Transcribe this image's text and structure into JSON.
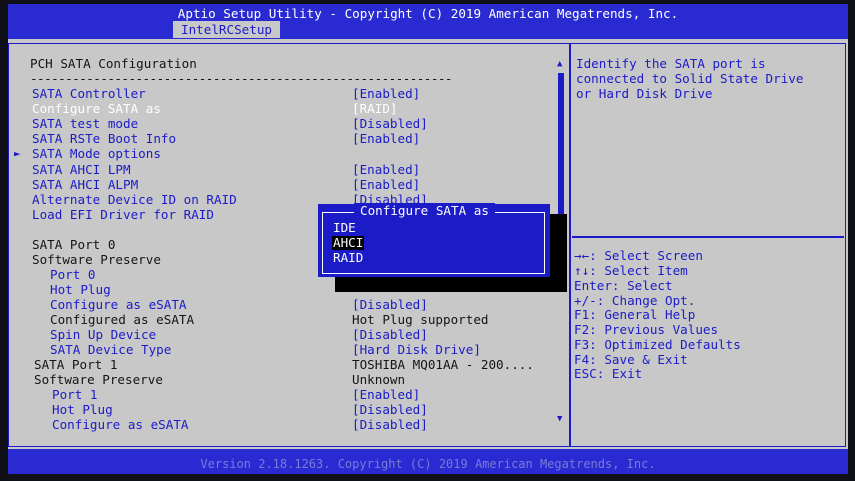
{
  "header": {
    "title": "Aptio Setup Utility - Copyright (C) 2019 American Megatrends, Inc.",
    "tab": "IntelRCSetup"
  },
  "section": {
    "title": "PCH SATA Configuration",
    "divider": "------------------------------------------------------------"
  },
  "pointer": "►",
  "settings": {
    "sata_controller": {
      "label": "SATA Controller",
      "value": "[Enabled]"
    },
    "configure_sata_as": {
      "label": "Configure SATA as",
      "value": "[RAID]"
    },
    "sata_test_mode": {
      "label": "SATA test mode",
      "value": "[Disabled]"
    },
    "sata_rste_boot_info": {
      "label": "SATA RSTe Boot Info",
      "value": "[Enabled]"
    },
    "sata_mode_options": {
      "label": "SATA Mode options"
    },
    "sata_ahci_lpm": {
      "label": "SATA AHCI LPM",
      "value": "[Enabled]"
    },
    "sata_ahci_alpm": {
      "label": "SATA AHCI ALPM",
      "value": "[Enabled]"
    },
    "alternate_device_id": {
      "label": "Alternate Device ID on RAID",
      "value": "[Disabled]"
    },
    "load_efi_driver": {
      "label": "Load EFI Driver for RAID"
    },
    "port0": {
      "header": "SATA Port 0",
      "software_preserve": "Software Preserve",
      "port_label": "Port 0",
      "hot_plug_label": "Hot Plug",
      "configure_esata": {
        "label": "Configure as eSATA",
        "value": "[Disabled]"
      },
      "configured_as_esata": {
        "label": "Configured as eSATA",
        "value": "Hot Plug supported"
      },
      "spin_up": {
        "label": "Spin Up Device",
        "value": "[Disabled]"
      },
      "device_type": {
        "label": "SATA Device Type",
        "value": "[Hard Disk Drive]"
      }
    },
    "port1": {
      "header": "SATA Port 1",
      "header_value": "TOSHIBA MQ01AA - 200....",
      "software_preserve": "Software Preserve",
      "software_preserve_value": "Unknown",
      "port": {
        "label": "Port 1",
        "value": "[Enabled]"
      },
      "hot_plug": {
        "label": "Hot Plug",
        "value": "[Disabled]"
      },
      "configure_esata": {
        "label": "Configure as eSATA",
        "value": "[Disabled]"
      }
    }
  },
  "popup": {
    "title": "Configure SATA as",
    "options": [
      "IDE",
      "AHCI",
      "RAID"
    ],
    "selected": "AHCI"
  },
  "help": {
    "lines": [
      "Identify the SATA port is",
      "connected to Solid State Drive",
      "or Hard Disk Drive"
    ]
  },
  "keys": [
    "→←: Select Screen",
    "↑↓: Select Item",
    "Enter: Select",
    "+/-: Change Opt.",
    "F1: General Help",
    "F2: Previous Values",
    "F3: Optimized Defaults",
    "F4: Save & Exit",
    "ESC: Exit"
  ],
  "scroll": {
    "up_icon": "▲",
    "down_icon": "▼"
  },
  "footer": "Version 2.18.1263. Copyright (C) 2019 American Megatrends, Inc."
}
